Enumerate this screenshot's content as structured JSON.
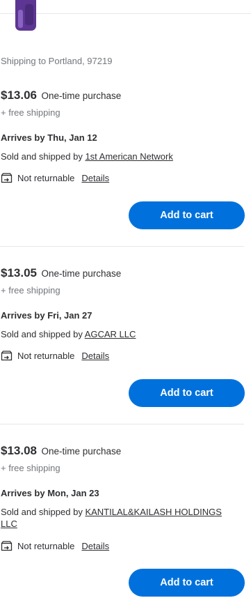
{
  "shipping_to": "Shipping to Portland, 97219",
  "offers": [
    {
      "price": "$13.06",
      "purchase_type": "One-time purchase",
      "shipping": "+ free shipping",
      "arrives": "Arrives by Thu, Jan 12",
      "sold_by_prefix": "Sold and shipped by",
      "seller": "1st American Network",
      "returns": "Not returnable",
      "details_label": "Details",
      "cart_label": "Add to cart"
    },
    {
      "price": "$13.05",
      "purchase_type": "One-time purchase",
      "shipping": "+ free shipping",
      "arrives": "Arrives by Fri, Jan 27",
      "sold_by_prefix": "Sold and shipped by",
      "seller": "AGCAR LLC",
      "returns": "Not returnable",
      "details_label": "Details",
      "cart_label": "Add to cart"
    },
    {
      "price": "$13.08",
      "purchase_type": "One-time purchase",
      "shipping": "+ free shipping",
      "arrives": "Arrives by Mon, Jan 23",
      "sold_by_prefix": "Sold and shipped by",
      "seller": "KANTILAL&KAILASH HOLDINGS LLC",
      "returns": "Not returnable",
      "details_label": "Details",
      "cart_label": "Add to cart"
    }
  ],
  "colors": {
    "accent": "#0071dc",
    "text": "#2e2f32",
    "muted": "#74767c",
    "divider": "#e6e7e8"
  },
  "icons": {
    "product": "product-thumbnail",
    "returns": "return-box-icon"
  }
}
